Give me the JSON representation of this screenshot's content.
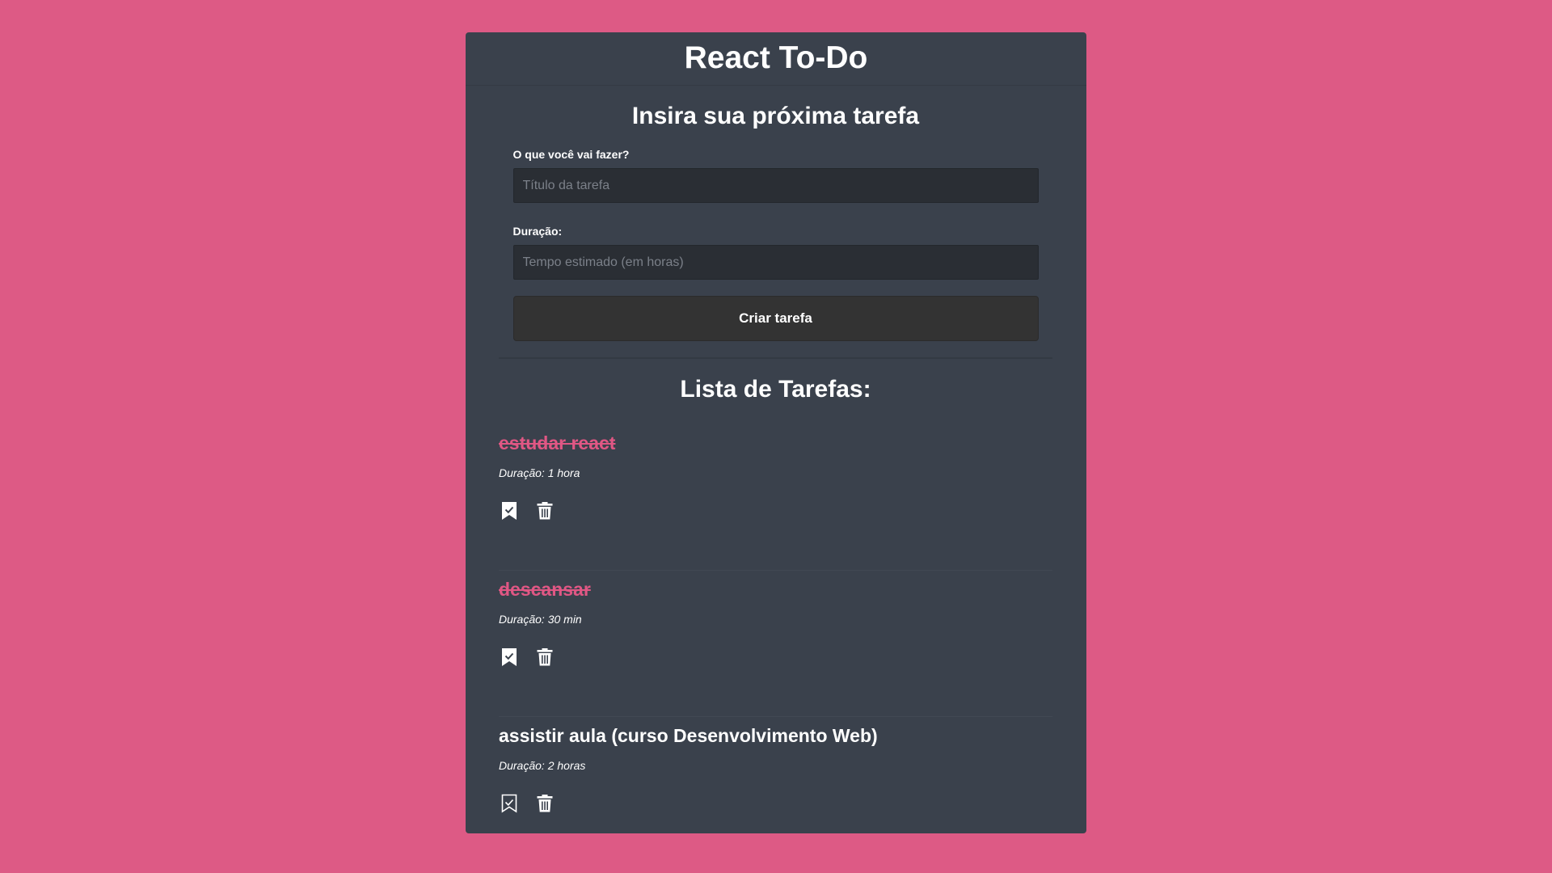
{
  "app": {
    "title": "React To-Do"
  },
  "form": {
    "heading": "Insira sua próxima tarefa",
    "title_label": "O que você vai fazer?",
    "title_placeholder": "Título da tarefa",
    "title_value": "",
    "duration_label": "Duração:",
    "duration_placeholder": "Tempo estimado (em horas)",
    "duration_value": "",
    "submit_label": "Criar tarefa"
  },
  "list": {
    "heading": "Lista de Tarefas:",
    "tasks": [
      {
        "title": "estudar react",
        "duration": "Duração: 1 hora",
        "completed": true,
        "complete_icon": "bookmark-check-filled-icon",
        "delete_icon": "trash-icon"
      },
      {
        "title": "descansar",
        "duration": "Duração: 30 min",
        "completed": true,
        "complete_icon": "bookmark-check-filled-icon",
        "delete_icon": "trash-icon"
      },
      {
        "title": "assistir aula (curso Desenvolvimento Web)",
        "duration": "Duração: 2 horas",
        "completed": false,
        "complete_icon": "bookmark-check-outline-icon",
        "delete_icon": "trash-icon"
      }
    ]
  },
  "colors": {
    "background": "#dd5a85",
    "card": "#3a414c",
    "input_bg": "#2a2e34",
    "button_bg": "#333333",
    "completed_text": "#e05784",
    "text": "#ffffff"
  }
}
